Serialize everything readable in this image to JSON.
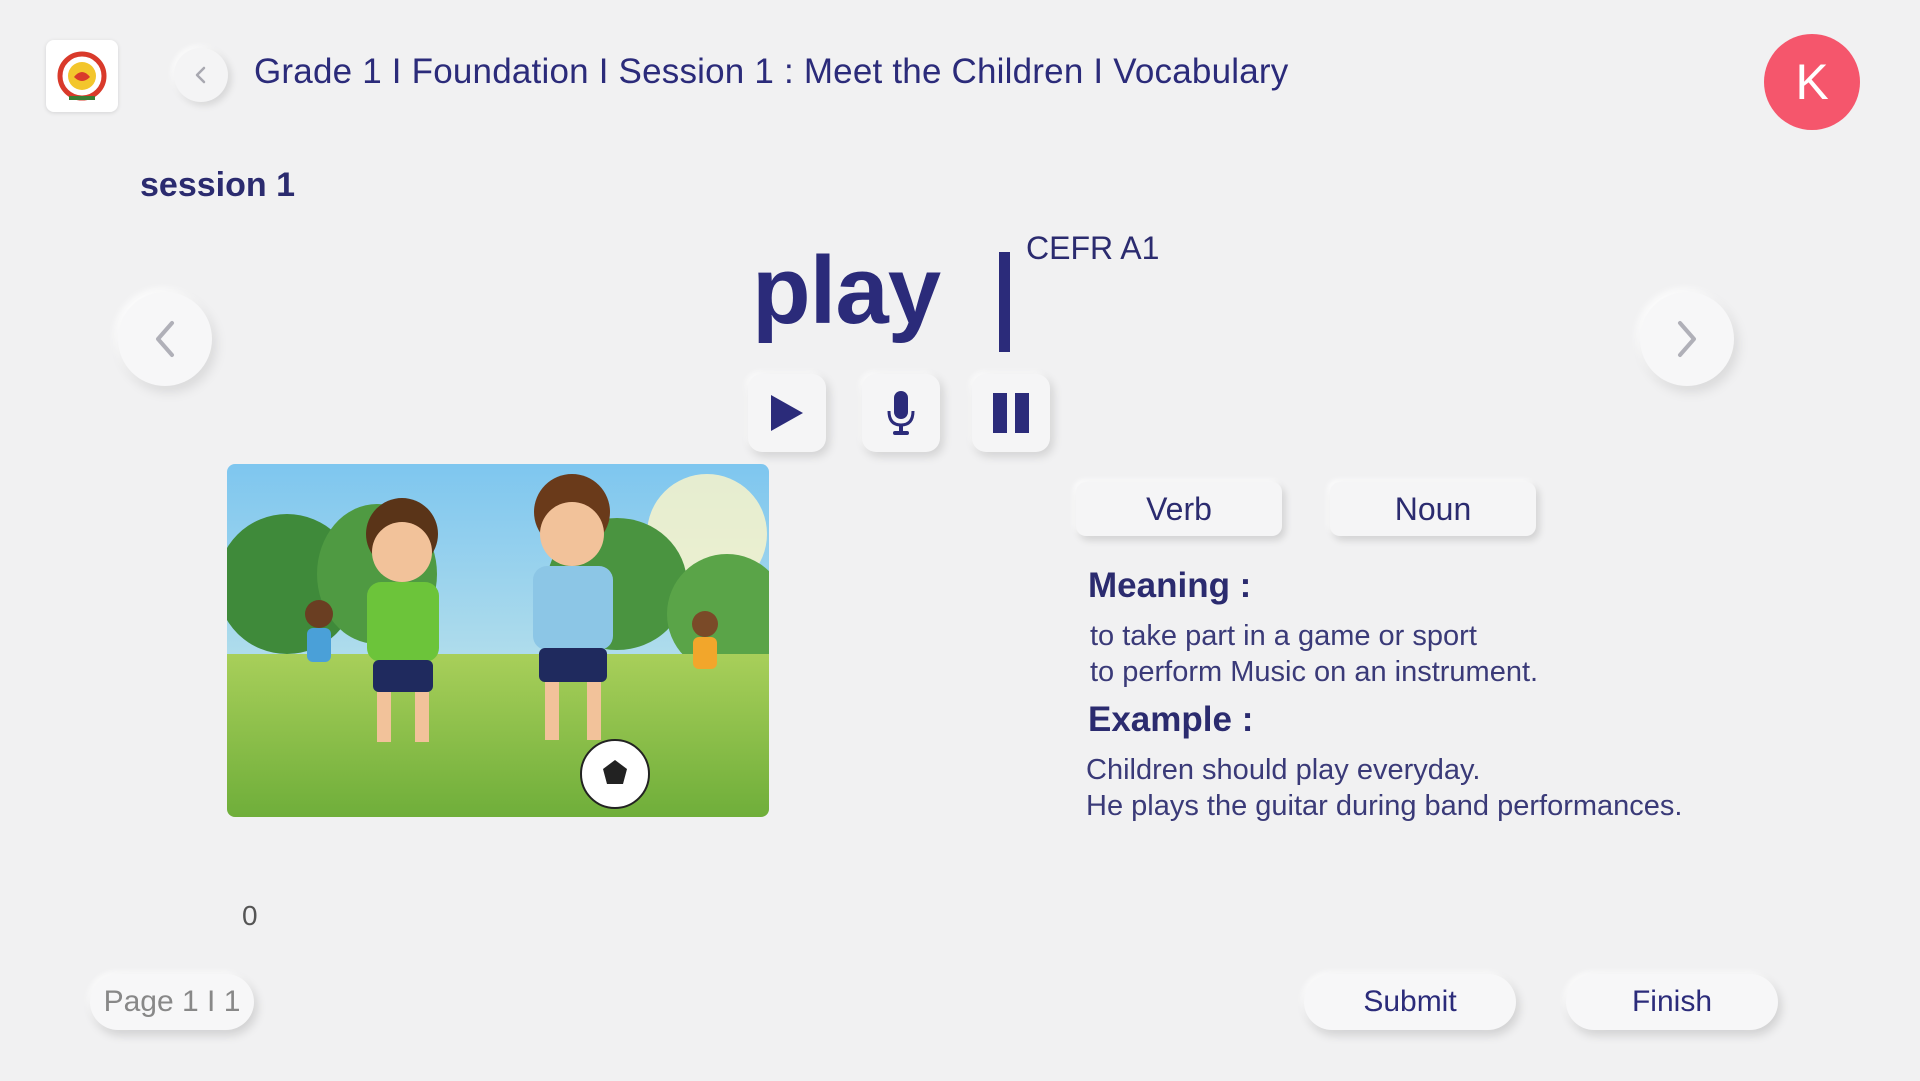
{
  "header": {
    "breadcrumb": "Grade 1 I Foundation I Session 1 : Meet the Children I Vocabulary",
    "avatar_initial": "K"
  },
  "session": {
    "label": "session 1"
  },
  "word": {
    "text": "play",
    "level": "CEFR A1"
  },
  "controls": {
    "play_icon": "play-icon",
    "mic_icon": "microphone-icon",
    "pause_icon": "pause-icon"
  },
  "parts_of_speech": [
    "Verb",
    "Noun"
  ],
  "meaning": {
    "title": "Meaning :",
    "lines": [
      "to take part in a game or sport",
      "to perform Music on an instrument."
    ]
  },
  "example": {
    "title": "Example :",
    "lines": [
      "Children should play everyday.",
      "He plays the guitar during band performances."
    ]
  },
  "progress": {
    "counter": "0"
  },
  "footer": {
    "page_label": "Page 1 I 1",
    "submit_label": "Submit",
    "finish_label": "Finish"
  },
  "colors": {
    "primary": "#2b2b7a",
    "avatar": "#f5566c",
    "background": "#f1f1f2"
  }
}
